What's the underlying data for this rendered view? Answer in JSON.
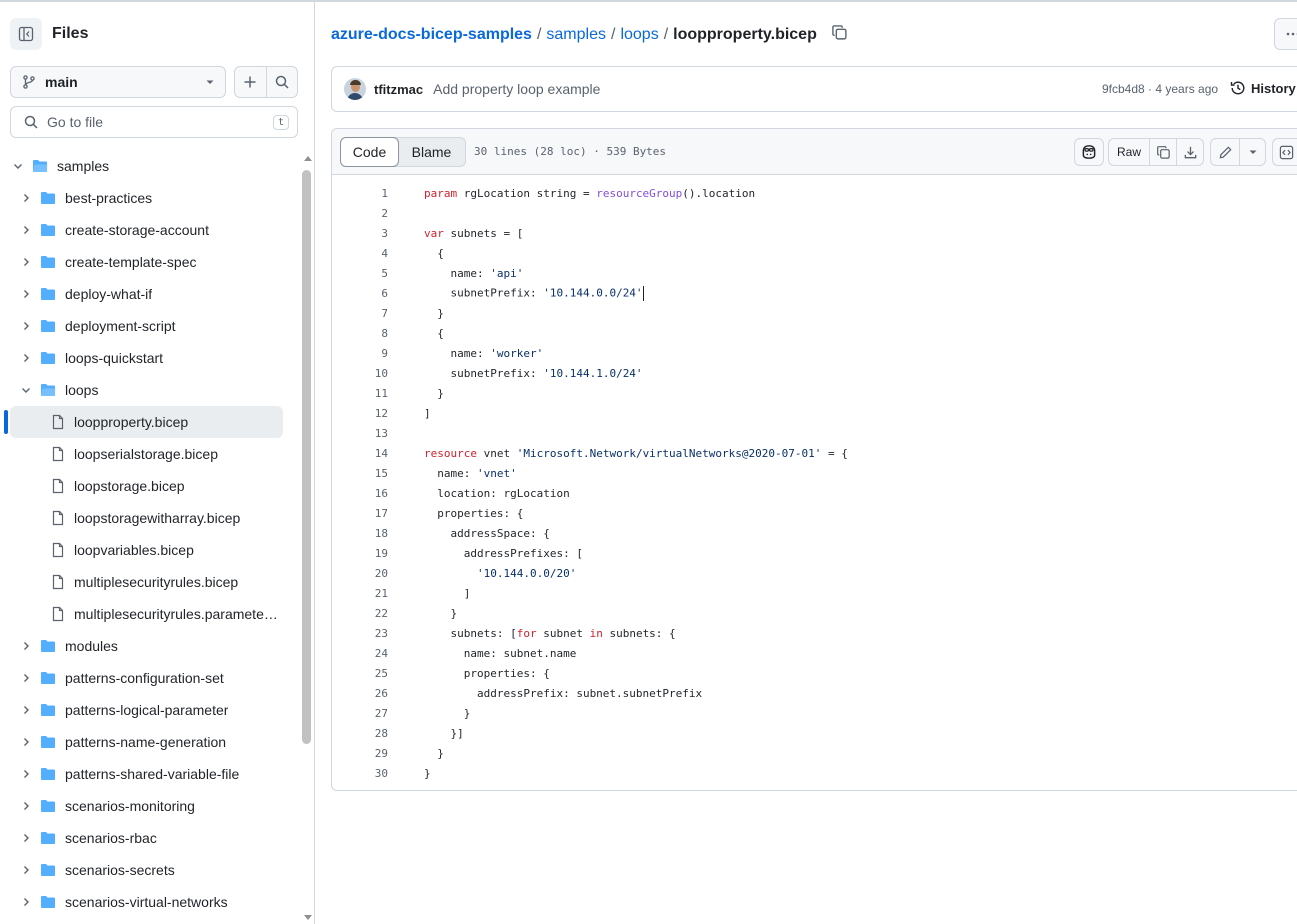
{
  "sidebar": {
    "title": "Files",
    "branch": "main",
    "goto_placeholder": "Go to file",
    "goto_shortcut": "t",
    "tree": [
      {
        "label": "samples",
        "type": "folder",
        "open": true,
        "depth": 0
      },
      {
        "label": "best-practices",
        "type": "folder",
        "open": false,
        "depth": 1
      },
      {
        "label": "create-storage-account",
        "type": "folder",
        "open": false,
        "depth": 1
      },
      {
        "label": "create-template-spec",
        "type": "folder",
        "open": false,
        "depth": 1
      },
      {
        "label": "deploy-what-if",
        "type": "folder",
        "open": false,
        "depth": 1
      },
      {
        "label": "deployment-script",
        "type": "folder",
        "open": false,
        "depth": 1
      },
      {
        "label": "loops-quickstart",
        "type": "folder",
        "open": false,
        "depth": 1
      },
      {
        "label": "loops",
        "type": "folder",
        "open": true,
        "depth": 1
      },
      {
        "label": "loopproperty.bicep",
        "type": "file",
        "depth": 2,
        "selected": true
      },
      {
        "label": "loopserialstorage.bicep",
        "type": "file",
        "depth": 2
      },
      {
        "label": "loopstorage.bicep",
        "type": "file",
        "depth": 2
      },
      {
        "label": "loopstoragewitharray.bicep",
        "type": "file",
        "depth": 2
      },
      {
        "label": "loopvariables.bicep",
        "type": "file",
        "depth": 2
      },
      {
        "label": "multiplesecurityrules.bicep",
        "type": "file",
        "depth": 2
      },
      {
        "label": "multiplesecurityrules.paramete…",
        "type": "file",
        "depth": 2
      },
      {
        "label": "modules",
        "type": "folder",
        "open": false,
        "depth": 1
      },
      {
        "label": "patterns-configuration-set",
        "type": "folder",
        "open": false,
        "depth": 1
      },
      {
        "label": "patterns-logical-parameter",
        "type": "folder",
        "open": false,
        "depth": 1
      },
      {
        "label": "patterns-name-generation",
        "type": "folder",
        "open": false,
        "depth": 1
      },
      {
        "label": "patterns-shared-variable-file",
        "type": "folder",
        "open": false,
        "depth": 1
      },
      {
        "label": "scenarios-monitoring",
        "type": "folder",
        "open": false,
        "depth": 1
      },
      {
        "label": "scenarios-rbac",
        "type": "folder",
        "open": false,
        "depth": 1
      },
      {
        "label": "scenarios-secrets",
        "type": "folder",
        "open": false,
        "depth": 1
      },
      {
        "label": "scenarios-virtual-networks",
        "type": "folder",
        "open": false,
        "depth": 1
      }
    ]
  },
  "breadcrumb": {
    "repo": "azure-docs-bicep-samples",
    "parts": [
      "samples",
      "loops"
    ],
    "file": "loopproperty.bicep",
    "sep": "/"
  },
  "commit": {
    "author": "tfitzmac",
    "message": "Add property loop example",
    "meta": "9fcb4d8 · 4 years ago",
    "history": "History"
  },
  "file": {
    "tab_code": "Code",
    "tab_blame": "Blame",
    "info": "30 lines (28 loc) · 539 Bytes",
    "raw": "Raw"
  },
  "code_lines": [
    [
      {
        "t": "param",
        "c": "kw"
      },
      {
        "t": " rgLocation string = "
      },
      {
        "t": "resourceGroup",
        "c": "fn"
      },
      {
        "t": "().location"
      }
    ],
    [],
    [
      {
        "t": "var",
        "c": "kw"
      },
      {
        "t": " subnets = ["
      }
    ],
    [
      {
        "t": "  {"
      }
    ],
    [
      {
        "t": "    name: "
      },
      {
        "t": "'api'",
        "c": "str"
      }
    ],
    [
      {
        "t": "    subnetPrefix: "
      },
      {
        "t": "'10.144.0.0/24'",
        "c": "str"
      },
      {
        "t": "",
        "caret": true
      }
    ],
    [
      {
        "t": "  }"
      }
    ],
    [
      {
        "t": "  {"
      }
    ],
    [
      {
        "t": "    name: "
      },
      {
        "t": "'worker'",
        "c": "str"
      }
    ],
    [
      {
        "t": "    subnetPrefix: "
      },
      {
        "t": "'10.144.1.0/24'",
        "c": "str"
      }
    ],
    [
      {
        "t": "  }"
      }
    ],
    [
      {
        "t": "]"
      }
    ],
    [],
    [
      {
        "t": "resource",
        "c": "kw"
      },
      {
        "t": " vnet "
      },
      {
        "t": "'Microsoft.Network/virtualNetworks@2020-07-01'",
        "c": "str"
      },
      {
        "t": " = {"
      }
    ],
    [
      {
        "t": "  name: "
      },
      {
        "t": "'vnet'",
        "c": "str"
      }
    ],
    [
      {
        "t": "  location: rgLocation"
      }
    ],
    [
      {
        "t": "  properties: {"
      }
    ],
    [
      {
        "t": "    addressSpace: {"
      }
    ],
    [
      {
        "t": "      addressPrefixes: ["
      }
    ],
    [
      {
        "t": "        "
      },
      {
        "t": "'10.144.0.0/20'",
        "c": "str"
      }
    ],
    [
      {
        "t": "      ]"
      }
    ],
    [
      {
        "t": "    }"
      }
    ],
    [
      {
        "t": "    subnets: ["
      },
      {
        "t": "for",
        "c": "kw"
      },
      {
        "t": " subnet "
      },
      {
        "t": "in",
        "c": "kw"
      },
      {
        "t": " subnets: {"
      }
    ],
    [
      {
        "t": "      name: subnet.name"
      }
    ],
    [
      {
        "t": "      properties: {"
      }
    ],
    [
      {
        "t": "        addressPrefix: subnet.subnetPrefix"
      }
    ],
    [
      {
        "t": "      }"
      }
    ],
    [
      {
        "t": "    }]"
      }
    ],
    [
      {
        "t": "  }"
      }
    ],
    [
      {
        "t": "}"
      }
    ]
  ],
  "colors": {
    "accent": "#0969da",
    "folder": "#54aeff",
    "keyword": "#cf222e",
    "string": "#0a3069",
    "function": "#8250df"
  }
}
